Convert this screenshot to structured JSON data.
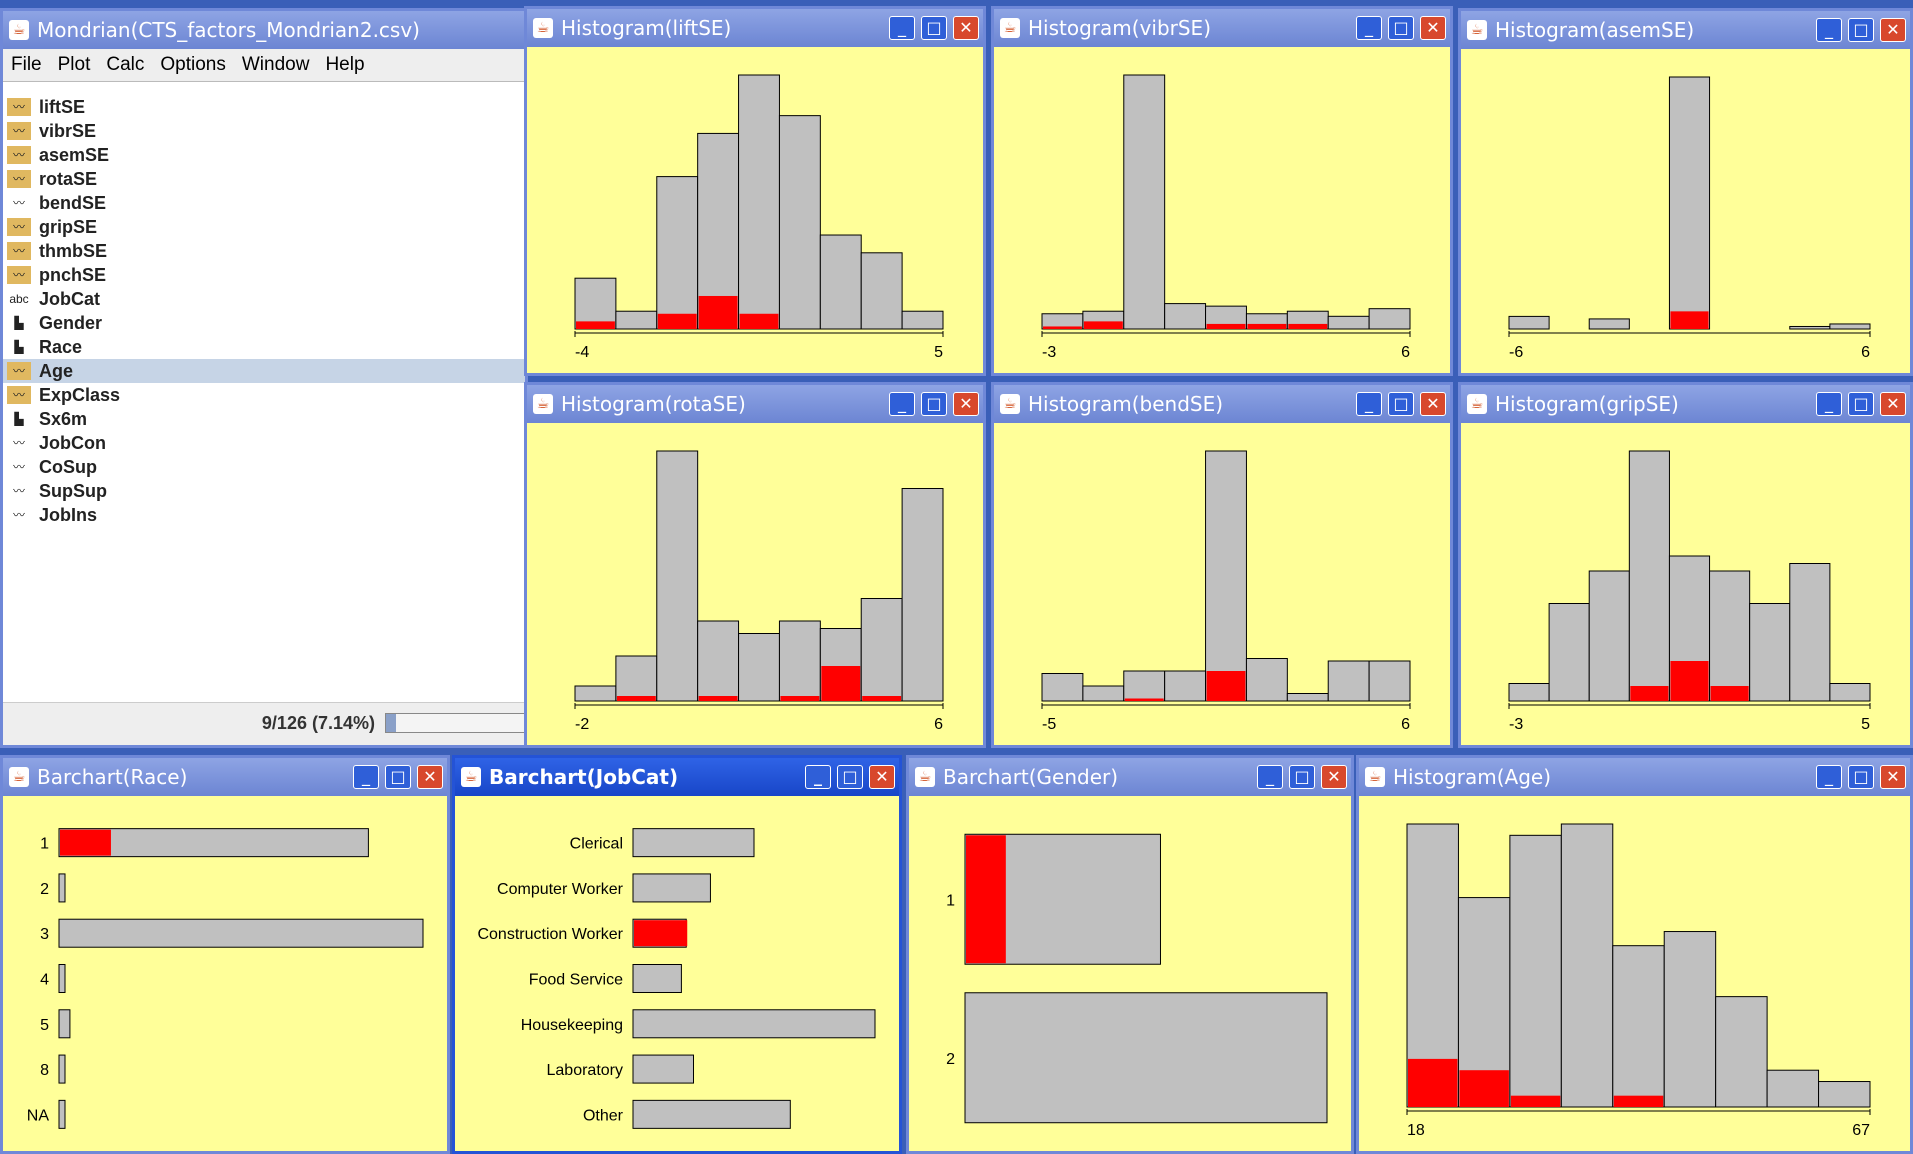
{
  "main_window": {
    "title": "Mondrian(CTS_factors_Mondrian2.csv)",
    "menu": [
      "File",
      "Plot",
      "Calc",
      "Options",
      "Window",
      "Help"
    ],
    "variables": [
      {
        "name": "liftSE",
        "icon": "line-chart-icon",
        "highlight": true
      },
      {
        "name": "vibrSE",
        "icon": "line-chart-icon",
        "highlight": true
      },
      {
        "name": "asemSE",
        "icon": "line-chart-icon",
        "highlight": true
      },
      {
        "name": "rotaSE",
        "icon": "line-chart-icon",
        "highlight": true
      },
      {
        "name": "bendSE",
        "icon": "line-chart-icon",
        "highlight": false
      },
      {
        "name": "gripSE",
        "icon": "line-chart-icon",
        "highlight": true
      },
      {
        "name": "thmbSE",
        "icon": "line-chart-icon",
        "highlight": true
      },
      {
        "name": "pnchSE",
        "icon": "line-chart-icon",
        "highlight": true
      },
      {
        "name": "JobCat",
        "icon": "text-abc-icon",
        "highlight": false
      },
      {
        "name": "Gender",
        "icon": "bar-chart-icon",
        "highlight": false
      },
      {
        "name": "Race",
        "icon": "bar-chart-icon",
        "highlight": false
      },
      {
        "name": "Age",
        "icon": "line-chart-icon",
        "highlight": true,
        "selected": true
      },
      {
        "name": "ExpClass",
        "icon": "line-chart-icon",
        "highlight": true
      },
      {
        "name": "Sx6m",
        "icon": "bar-chart-icon",
        "highlight": false
      },
      {
        "name": "JobCon",
        "icon": "line-chart-icon",
        "highlight": false
      },
      {
        "name": "CoSup",
        "icon": "line-chart-icon",
        "highlight": false
      },
      {
        "name": "SupSup",
        "icon": "line-chart-icon",
        "highlight": false
      },
      {
        "name": "JobIns",
        "icon": "line-chart-icon",
        "highlight": false
      }
    ],
    "status": "9/126 (7.14%)",
    "progress": 0.0714
  },
  "colors": {
    "background": "#ffff99",
    "bar": "#c0c0c0",
    "selected": "#ff0000"
  },
  "chart_data": [
    {
      "id": "liftSE",
      "type": "bar",
      "title": "Histogram(liftSE)",
      "xlim": [
        "-4",
        "5"
      ],
      "values": [
        0.2,
        0.07,
        0.6,
        0.77,
        1.0,
        0.84,
        0.37,
        0.3,
        0.07
      ],
      "selected": [
        0.03,
        0,
        0.06,
        0.13,
        0.06,
        0,
        0,
        0,
        0
      ]
    },
    {
      "id": "vibrSE",
      "type": "bar",
      "title": "Histogram(vibrSE)",
      "xlim": [
        "-3",
        "6"
      ],
      "values": [
        0.06,
        0.07,
        1.0,
        0.1,
        0.09,
        0.06,
        0.07,
        0.05,
        0.08
      ],
      "selected": [
        0.01,
        0.03,
        0,
        0,
        0.02,
        0.02,
        0.02,
        0,
        0
      ]
    },
    {
      "id": "asemSE",
      "type": "bar",
      "title": "Histogram(asemSE)",
      "xlim": [
        "-6",
        "6"
      ],
      "values": [
        0.05,
        0,
        0.04,
        0,
        1.0,
        0,
        0,
        0.01,
        0.02
      ],
      "selected": [
        0,
        0,
        0,
        0,
        0.07,
        0,
        0,
        0,
        0
      ]
    },
    {
      "id": "rotaSE",
      "type": "bar",
      "title": "Histogram(rotaSE)",
      "xlim": [
        "-2",
        "6"
      ],
      "values": [
        0.06,
        0.18,
        1.0,
        0.32,
        0.27,
        0.32,
        0.29,
        0.41,
        0.85
      ],
      "selected": [
        0,
        0.02,
        0,
        0.02,
        0,
        0.02,
        0.14,
        0.02,
        0
      ]
    },
    {
      "id": "bendSE",
      "type": "bar",
      "title": "Histogram(bendSE)",
      "xlim": [
        "-5",
        "6"
      ],
      "values": [
        0.11,
        0.06,
        0.12,
        0.12,
        1.0,
        0.17,
        0.03,
        0.16,
        0.16
      ],
      "selected": [
        0,
        0,
        0.01,
        0,
        0.12,
        0,
        0,
        0,
        0
      ]
    },
    {
      "id": "gripSE",
      "type": "bar",
      "title": "Histogram(gripSE)",
      "xlim": [
        "-3",
        "5"
      ],
      "values": [
        0.07,
        0.39,
        0.52,
        1.0,
        0.58,
        0.52,
        0.39,
        0.55,
        0.07
      ],
      "selected": [
        0,
        0,
        0,
        0.06,
        0.16,
        0.06,
        0,
        0,
        0
      ]
    },
    {
      "id": "Race",
      "type": "bar",
      "orientation": "horizontal",
      "title": "Barchart(Race)",
      "categories": [
        "1",
        "2",
        "3",
        "4",
        "5",
        "8",
        "NA"
      ],
      "values": [
        0.85,
        0.01,
        1.0,
        0.01,
        0.03,
        0.01,
        0.01
      ],
      "selected": [
        0.14,
        0,
        0,
        0,
        0,
        0,
        0
      ]
    },
    {
      "id": "JobCat",
      "type": "bar",
      "orientation": "horizontal",
      "title": "Barchart(JobCat)",
      "categories": [
        "Clerical",
        "Computer Worker",
        "Construction Worker",
        "Food Service",
        "Housekeeping",
        "Laboratory",
        "Other"
      ],
      "values": [
        0.5,
        0.32,
        0.22,
        0.2,
        1.0,
        0.25,
        0.65
      ],
      "selected": [
        0,
        0,
        0.22,
        0,
        0,
        0,
        0
      ]
    },
    {
      "id": "Gender",
      "type": "bar",
      "orientation": "horizontal",
      "title": "Barchart(Gender)",
      "categories": [
        "1",
        "2"
      ],
      "values": [
        0.54,
        1.0
      ],
      "selected": [
        0.11,
        0
      ]
    },
    {
      "id": "Age",
      "type": "bar",
      "title": "Histogram(Age)",
      "xlim": [
        "18",
        "67"
      ],
      "values": [
        1.0,
        0.74,
        0.96,
        1.0,
        0.57,
        0.62,
        0.39,
        0.13,
        0.09
      ],
      "selected": [
        0.17,
        0.13,
        0.04,
        0,
        0.04,
        0,
        0,
        0,
        0
      ]
    }
  ]
}
